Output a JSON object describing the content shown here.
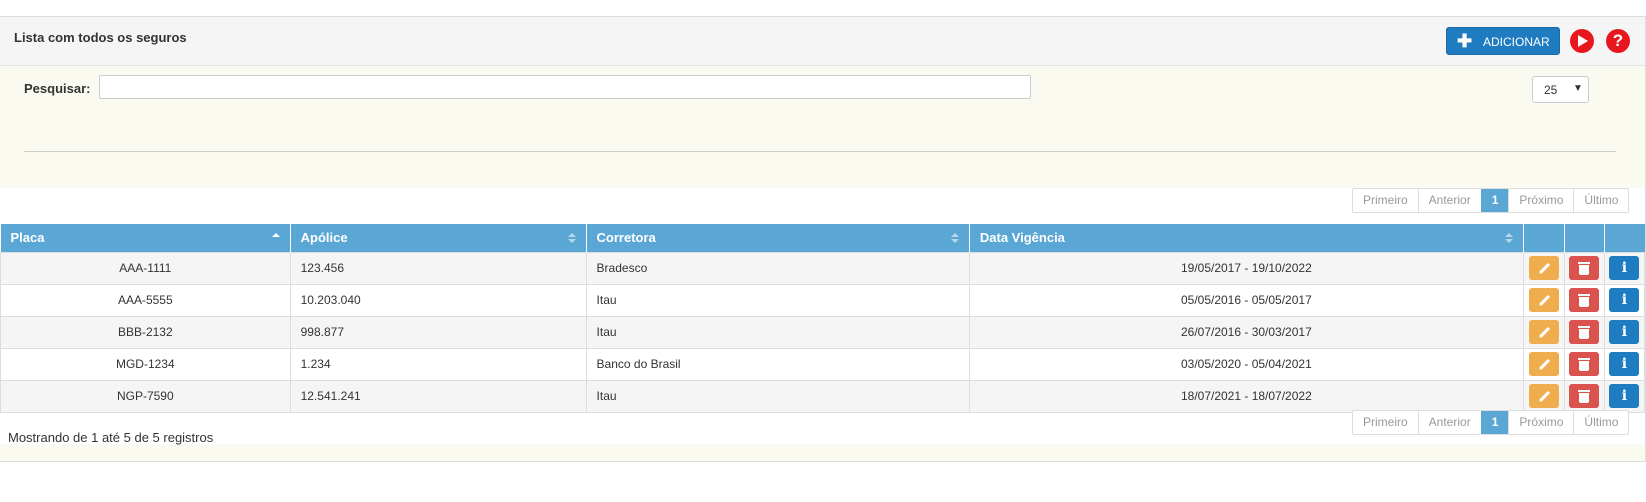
{
  "header": {
    "title": "Lista com todos os seguros",
    "add_label": "ADICIONAR",
    "help_glyph": "?"
  },
  "search": {
    "label": "Pesquisar:",
    "value": "",
    "placeholder": ""
  },
  "page_size": {
    "selected": "25"
  },
  "pagination": {
    "labels": [
      "Primeiro",
      "Anterior",
      "1",
      "Próximo",
      "Último"
    ],
    "current": "1"
  },
  "table": {
    "columns": [
      "Placa",
      "Apólice",
      "Corretora",
      "Data Vigência",
      "",
      "",
      ""
    ],
    "sorted_column": "Placa",
    "sort_direction": "asc",
    "rows": [
      {
        "placa": "AAA-1111",
        "apolice": "123.456",
        "corretora": "Bradesco",
        "vigencia": "19/05/2017 - 19/10/2022"
      },
      {
        "placa": "AAA-5555",
        "apolice": "10.203.040",
        "corretora": "Itau",
        "vigencia": "05/05/2016 - 05/05/2017"
      },
      {
        "placa": "BBB-2132",
        "apolice": "998.877",
        "corretora": "Itau",
        "vigencia": "26/07/2016 - 30/03/2017"
      },
      {
        "placa": "MGD-1234",
        "apolice": "1.234",
        "corretora": "Banco do Brasil",
        "vigencia": "03/05/2020 - 05/04/2021"
      },
      {
        "placa": "NGP-7590",
        "apolice": "12.541.241",
        "corretora": "Itau",
        "vigencia": "18/07/2021 - 18/07/2022"
      }
    ],
    "row_actions": [
      {
        "name": "edit-button",
        "icon": "pencil-icon"
      },
      {
        "name": "delete-button",
        "icon": "trash-icon"
      },
      {
        "name": "info-button",
        "icon": "info-icon",
        "glyph": "i"
      }
    ]
  },
  "footer": {
    "info": "Mostrando de 1 até 5 de 5 registros"
  },
  "colors": {
    "header_bg": "#5aa7d6",
    "primary": "#1f7cc1",
    "edit": "#f0ad4e",
    "delete": "#d9534f",
    "accent_red": "#e8171f",
    "panel_bg": "#fafaf0"
  },
  "icons": [
    "plus-icon",
    "play-icon",
    "help-icon",
    "chevron-down-icon",
    "sort-icon",
    "pencil-icon",
    "trash-icon",
    "info-icon"
  ]
}
